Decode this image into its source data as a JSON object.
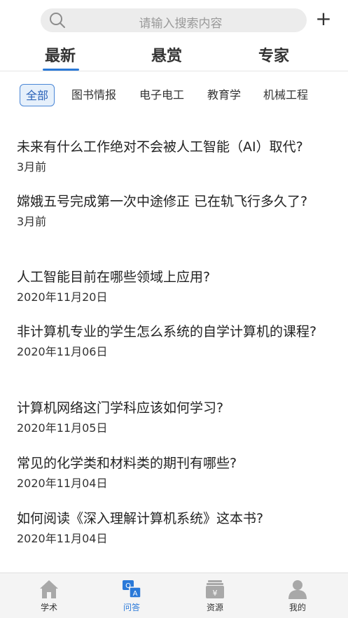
{
  "search": {
    "placeholder": "请输入搜索内容",
    "add_label": "+"
  },
  "tabs": [
    {
      "label": "最新",
      "active": true
    },
    {
      "label": "悬赏",
      "active": false
    },
    {
      "label": "专家",
      "active": false
    }
  ],
  "categories": [
    {
      "label": "全部",
      "active": true
    },
    {
      "label": "图书情报",
      "active": false
    },
    {
      "label": "电子电工",
      "active": false
    },
    {
      "label": "教育学",
      "active": false
    },
    {
      "label": "机械工程",
      "active": false
    }
  ],
  "questions": [
    {
      "title": "未来有什么工作绝对不会被人工智能（AI）取代?",
      "date": "3月前"
    },
    {
      "title": "嫦娥五号完成第一次中途修正 已在轨飞行多久了?",
      "date": "3月前"
    },
    {
      "title": "人工智能目前在哪些领域上应用?",
      "date": "2020年11月20日"
    },
    {
      "title": "非计算机专业的学生怎么系统的自学计算机的课程?",
      "date": "2020年11月06日"
    },
    {
      "title": "计算机网络这门学科应该如何学习?",
      "date": "2020年11月05日"
    },
    {
      "title": "常见的化学类和材料类的期刊有哪些?",
      "date": "2020年11月04日"
    },
    {
      "title": "如何阅读《深入理解计算机系统》这本书?",
      "date": "2020年11月04日"
    }
  ],
  "bottom_nav": [
    {
      "label": "学术",
      "icon": "home-icon",
      "active": false
    },
    {
      "label": "问答",
      "icon": "qa-icon",
      "active": true
    },
    {
      "label": "资源",
      "icon": "resource-icon",
      "active": false
    },
    {
      "label": "我的",
      "icon": "user-icon",
      "active": false
    }
  ],
  "colors": {
    "accent": "#2a79d8",
    "inactive_icon": "#a8a8a8"
  }
}
